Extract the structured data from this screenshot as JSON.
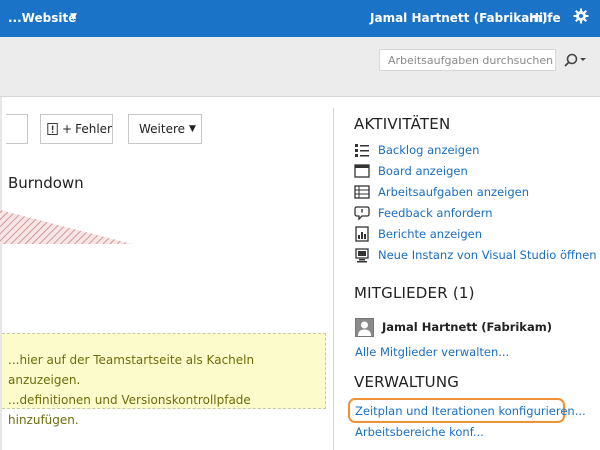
{
  "topbar": {
    "project": "...Website",
    "user": "Jamal Hartnett (Fabrikam)",
    "help": "Hilfe"
  },
  "search": {
    "placeholder": "Arbeitsaufgaben durchsuchen"
  },
  "toolbar": {
    "bug_label": "Fehler",
    "bug_plus": "+",
    "more_label": "Weitere"
  },
  "burndown": {
    "title": "Burndown"
  },
  "tip": {
    "line1": "...hier auf der Teamstartseite als Kacheln anzuzeigen.",
    "line2": "...definitionen und Versionskontrollpfade hinzufügen."
  },
  "activities": {
    "title": "AKTIVITÄTEN",
    "items": [
      {
        "label": "Backlog anzeigen",
        "icon": "list-icon"
      },
      {
        "label": "Board anzeigen",
        "icon": "board-icon"
      },
      {
        "label": "Arbeitsaufgaben anzeigen",
        "icon": "table-icon"
      },
      {
        "label": "Feedback anfordern",
        "icon": "feedback-icon"
      },
      {
        "label": "Berichte anzeigen",
        "icon": "report-icon"
      },
      {
        "label": "Neue Instanz von Visual Studio öffnen",
        "icon": "visual-studio-icon"
      }
    ]
  },
  "members": {
    "title": "MITGLIEDER (1)",
    "list": [
      {
        "name": "Jamal Hartnett (Fabrikam)"
      }
    ],
    "manage_link": "Alle Mitglieder verwalten..."
  },
  "admin": {
    "title": "VERWALTUNG",
    "links": [
      {
        "label": "Zeitplan und Iterationen konfigurieren...",
        "highlighted": true
      },
      {
        "label": "Arbeitsbereiche konf..."
      }
    ]
  },
  "colors": {
    "topbar": "#1a73c7",
    "link": "#1a6fbf",
    "highlight": "#f0913a",
    "tip_background": "#fbfbcc",
    "tip_text": "#6d6d0c"
  }
}
